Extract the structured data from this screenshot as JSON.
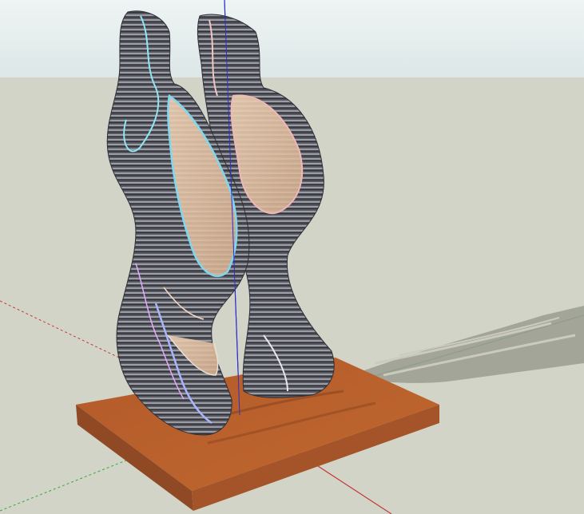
{
  "viewport": {
    "type": "3d-model-view",
    "colors": {
      "sky": "#e3ecec",
      "ground": "#d3d4c8",
      "base_top": "#b9602d",
      "base_front": "#8f4a25",
      "shadow": "#9c9d91",
      "axis_red": "#c43a3a",
      "axis_green": "#3aa63a",
      "axis_blue": "#2f2fd0",
      "frame_dark": "#3f3f46",
      "frame_light": "#c8cbd3",
      "glass": "#e7c6a8"
    },
    "icons": [
      "sculpture-model",
      "axis-lines",
      "base-block",
      "shadow"
    ]
  }
}
